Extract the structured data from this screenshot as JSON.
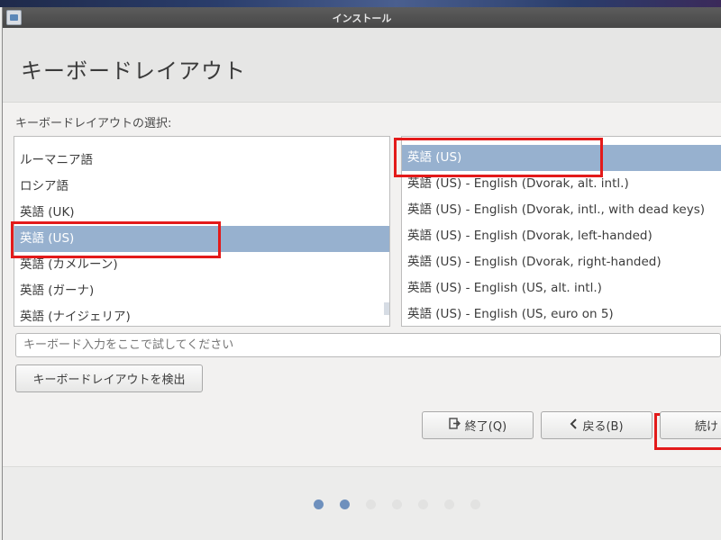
{
  "window": {
    "title": "インストール"
  },
  "page": {
    "title": "キーボードレイアウト",
    "section_label": "キーボードレイアウトの選択:"
  },
  "layouts_left": [
    {
      "label": "ルーマニア語",
      "selected": false
    },
    {
      "label": "ロシア語",
      "selected": false
    },
    {
      "label": "英語 (UK)",
      "selected": false
    },
    {
      "label": "英語 (US)",
      "selected": true
    },
    {
      "label": "英語 (カメルーン)",
      "selected": false
    },
    {
      "label": "英語 (ガーナ)",
      "selected": false
    },
    {
      "label": "英語 (ナイジェリア)",
      "selected": false
    }
  ],
  "variants_right": [
    {
      "label": "英語 (US)",
      "selected": true
    },
    {
      "label": "英語 (US) - English (Dvorak, alt. intl.)",
      "selected": false
    },
    {
      "label": "英語 (US) - English (Dvorak, intl., with dead keys)",
      "selected": false
    },
    {
      "label": "英語 (US) - English (Dvorak, left-handed)",
      "selected": false
    },
    {
      "label": "英語 (US) - English (Dvorak, right-handed)",
      "selected": false
    },
    {
      "label": "英語 (US) - English (US, alt. intl.)",
      "selected": false
    },
    {
      "label": "英語 (US) - English (US, euro on 5)",
      "selected": false
    }
  ],
  "test_input": {
    "placeholder": "キーボード入力をここで試してください",
    "value": ""
  },
  "buttons": {
    "detect": "キーボードレイアウトを検出",
    "quit": "終了(Q)",
    "back": "戻る(B)",
    "continue": "続け"
  },
  "progress": {
    "current_step": 2,
    "total_steps": 7
  },
  "colors": {
    "selection": "#97b1cf",
    "highlight_box": "#e31a1a",
    "active_dot": "#6e90bd"
  },
  "icons": {
    "quit": "exit-icon",
    "back": "chevron-left-icon"
  }
}
